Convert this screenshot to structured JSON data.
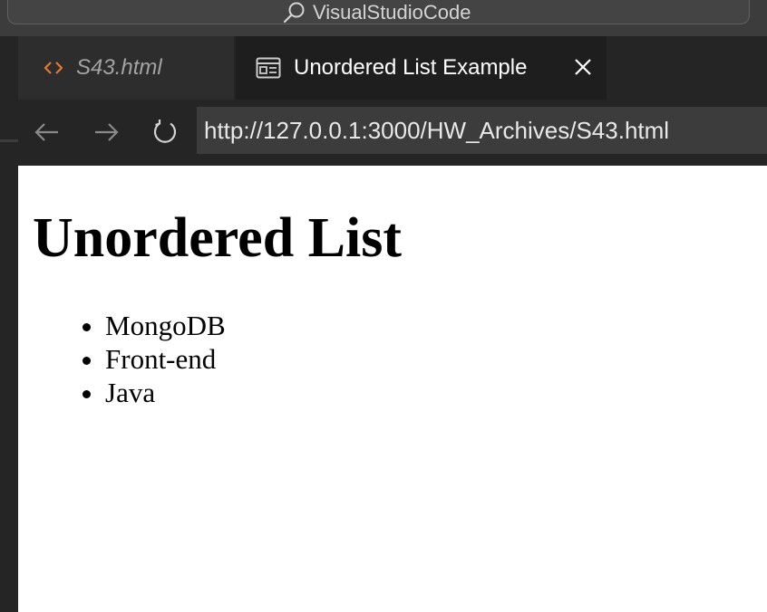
{
  "window": {
    "command_center_text": "VisualStudioCode"
  },
  "tabs": [
    {
      "label": "S43.html",
      "icon": "html-code-icon",
      "active": false
    },
    {
      "label": "Unordered List Example",
      "icon": "preview-icon",
      "active": true
    }
  ],
  "nav": {
    "back_icon": "arrow-left-icon",
    "forward_icon": "arrow-right-icon",
    "reload_icon": "reload-icon",
    "url": "http://127.0.0.1:3000/HW_Archives/S43.html"
  },
  "page": {
    "heading": "Unordered List",
    "items": [
      "MongoDB",
      "Front-end",
      "Java"
    ]
  },
  "colors": {
    "titlebar": "#3c3c3c",
    "tabbar": "#252526",
    "active_tab": "#1e1e1e",
    "html_icon": "#e37933",
    "url_bar": "#3c3c3c"
  }
}
